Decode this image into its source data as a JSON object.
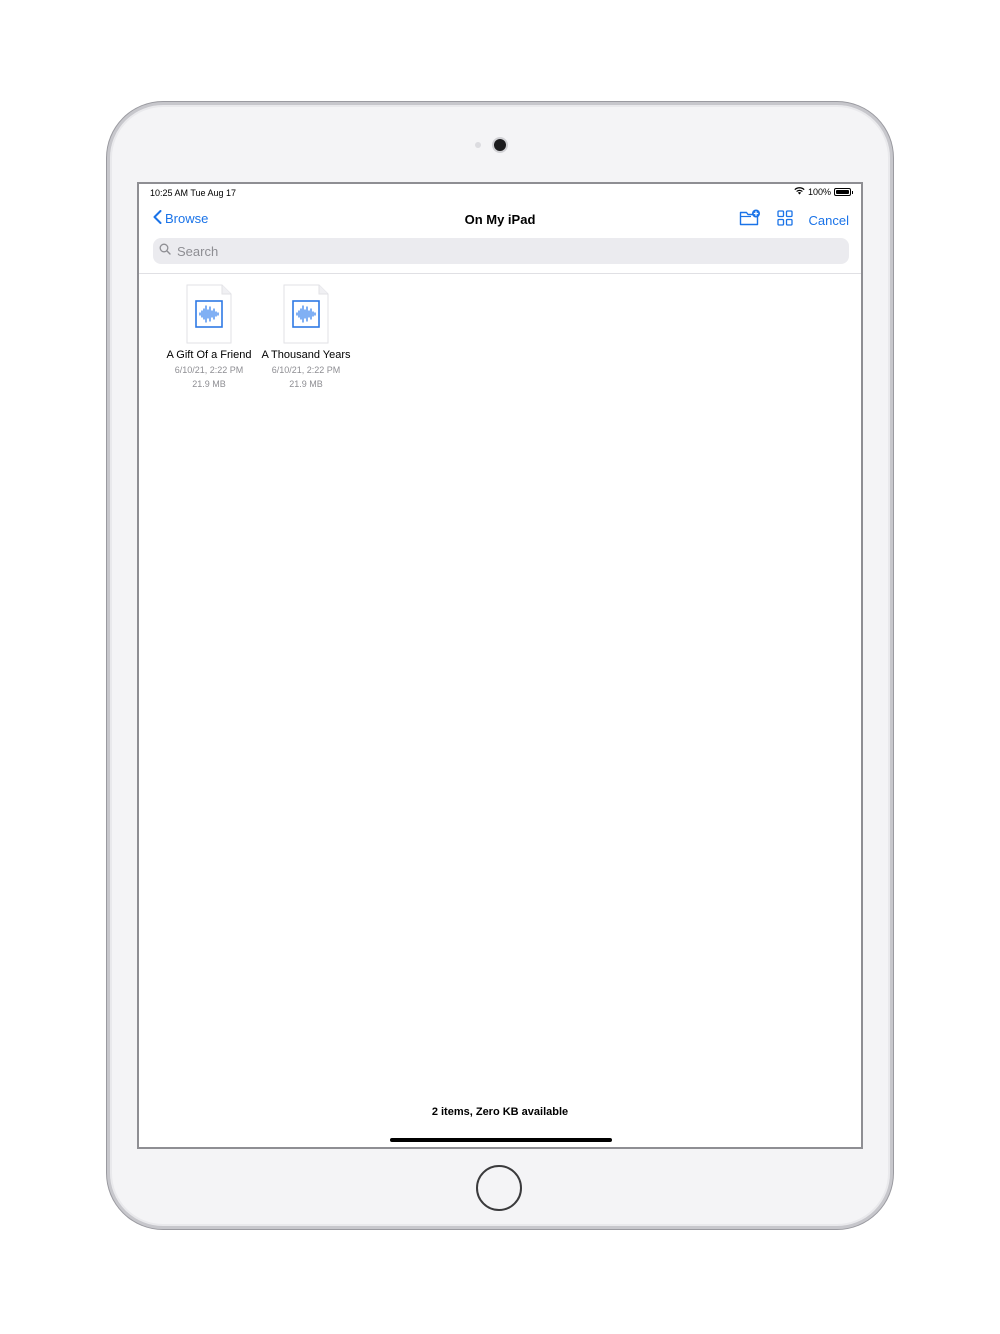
{
  "status_bar": {
    "time": "10:25 AM   Tue Aug 17",
    "battery": "100%",
    "battery_level": 1.0
  },
  "nav": {
    "back_label": "Browse",
    "title": "On My iPad",
    "cancel_label": "Cancel",
    "icons": [
      "chevron-left-icon",
      "new-folder-icon",
      "grid-view-icon"
    ]
  },
  "search": {
    "placeholder": "Search"
  },
  "files": [
    {
      "name": "A Gift Of a Friend",
      "date": "6/10/21, 2:22 PM",
      "size": "21.9 MB",
      "icon": "audio-file-icon"
    },
    {
      "name": "A Thousand Years",
      "date": "6/10/21, 2:22 PM",
      "size": "21.9 MB",
      "icon": "audio-file-icon"
    }
  ],
  "footer": {
    "summary": "2 items, Zero KB available"
  },
  "colors": {
    "accent": "#1a73e8",
    "secondary_text": "#8e8e93",
    "search_bg": "#ebebef"
  }
}
